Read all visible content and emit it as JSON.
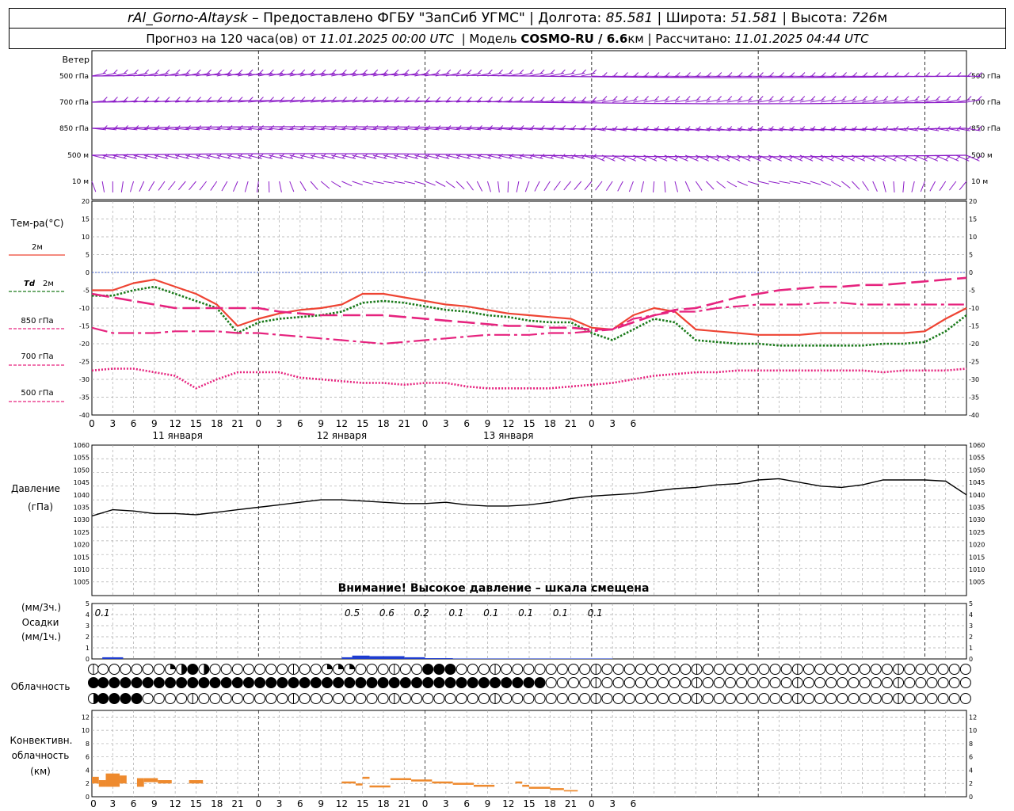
{
  "header": {
    "station": "rAl_Gorno-Altaysk",
    "provider": " – Предоставлено ФГБУ \"ЗапСиб УГМС\" | Долгота: ",
    "lon": "85.581",
    "lat_label": " | Широта: ",
    "lat": "51.581",
    "alt_label": " | Высота: ",
    "alt": "726",
    "alt_unit": "м",
    "fc_label": "Прогноз на 120 часа(ов) от ",
    "fc_time": "11.01.2025 00:00 UTC",
    "model_label": "  | Модель ",
    "model": "COSMO-RU / 6.6",
    "model_unit": "км",
    "calc_label": " | Рассчитано: ",
    "calc_time": "11.01.2025 04:44 UTC"
  },
  "colors": {
    "wind": "#8c1cc8",
    "t2m": "#ee4433",
    "td2m": "#1a7a1a",
    "t850": "#e6237e",
    "t700": "#e6237e",
    "t500": "#e6237e",
    "pressure": "#000000",
    "precip": "#1e3ccf",
    "conv": "#ee8a2e",
    "zero_line": "#4060d0"
  },
  "axes": {
    "hour_ticks": [
      "0",
      "3",
      "6",
      "9",
      "12",
      "15",
      "18",
      "21",
      "0",
      "3",
      "6",
      "9",
      "12",
      "15",
      "18",
      "21",
      "0",
      "3",
      "6",
      "9",
      "12",
      "15",
      "18",
      "21",
      "0",
      "3",
      "6"
    ],
    "days": [
      "11 января",
      "12 января",
      "13 января"
    ],
    "temp_ticks": [
      "20",
      "15",
      "10",
      "5",
      "0",
      "-5",
      "-10",
      "-15",
      "-20",
      "-25",
      "-30",
      "-35",
      "-40"
    ],
    "press_ticks": [
      "1060",
      "1055",
      "1050",
      "1045",
      "1040",
      "1035",
      "1030",
      "1025",
      "1020",
      "1015",
      "1010",
      "1005"
    ],
    "precip_ticks": [
      "5",
      "4",
      "3",
      "2",
      "1",
      "0"
    ],
    "conv_ticks": [
      "12",
      "10",
      "8",
      "6",
      "4",
      "2",
      "0"
    ]
  },
  "labels": {
    "wind": "Ветер",
    "wind_levels": [
      "500 гПа",
      "700 гПа",
      "850 гПа",
      "500  м",
      "10   м"
    ],
    "temp": "Тем-ра(°С)",
    "t2m": "2м",
    "td": "Td",
    "td2m": "2м",
    "t850": "850 гПа",
    "t700": "700 гПа",
    "t500": "500 гПа",
    "pressure1": "Давление",
    "pressure2": "(гПа)",
    "pressure_warning": "Внимание! Высокое давление – шкала смещена",
    "precip1": "(мм/3ч.)",
    "precip2": "Осадки",
    "precip3": "(мм/1ч.)",
    "cloud": "Облачность",
    "conv1": "Конвективн.",
    "conv2": "облачность",
    "conv3": "(км)"
  },
  "chart_data": [
    {
      "type": "line",
      "title": "Тем-ра(°С)",
      "x_hours": [
        0,
        3,
        6,
        9,
        12,
        15,
        18,
        21,
        24,
        27,
        30,
        33,
        36,
        39,
        42,
        45,
        48,
        51,
        54,
        57,
        60,
        63,
        66,
        69,
        72,
        75,
        78,
        81,
        84,
        87,
        90,
        93,
        96,
        99,
        102,
        105,
        108,
        111,
        114,
        117,
        120,
        123,
        126
      ],
      "ylim": [
        -40,
        20
      ],
      "series": [
        {
          "name": "2м",
          "style": "solid",
          "values": [
            -5,
            -5,
            -3,
            -2,
            -4,
            -6,
            -9,
            -15,
            -13,
            -11.5,
            -10.5,
            -10,
            -9,
            -6,
            -6,
            -7,
            -8,
            -9,
            -9.5,
            -10.5,
            -11.5,
            -12,
            -12.5,
            -13,
            -15.5,
            -16,
            -12,
            -10,
            -11,
            -16,
            -16.5,
            -17,
            -17.5,
            -17.5,
            -17.5,
            -17,
            -17,
            -17,
            -17,
            -17,
            -16.5,
            -13,
            -10
          ]
        },
        {
          "name": "Td 2м",
          "style": "dotted",
          "values": [
            -6.5,
            -6.5,
            -5,
            -4,
            -6,
            -8,
            -10,
            -17,
            -14,
            -13,
            -12.5,
            -12,
            -11,
            -8.5,
            -8,
            -8.5,
            -9.5,
            -10.5,
            -11,
            -12,
            -12.5,
            -13.5,
            -14,
            -14,
            -17,
            -19,
            -16,
            -13,
            -14,
            -19,
            -19.5,
            -20,
            -20,
            -20.5,
            -20.5,
            -20.5,
            -20.5,
            -20.5,
            -20,
            -20,
            -19.5,
            -16.5,
            -12
          ]
        },
        {
          "name": "850 гПа",
          "style": "long-dash",
          "values": [
            -6,
            -7,
            -8,
            -9,
            -10,
            -10,
            -10,
            -10,
            -10,
            -11,
            -11.5,
            -12,
            -12,
            -12,
            -12,
            -12.5,
            -13,
            -13.5,
            -14,
            -14.5,
            -15,
            -15,
            -15.5,
            -15.5,
            -16,
            -16,
            -14,
            -12,
            -10.5,
            -10,
            -8.5,
            -7,
            -6,
            -5,
            -4.5,
            -4,
            -4,
            -3.5,
            -3.5,
            -3,
            -2.5,
            -2,
            -1.5
          ]
        },
        {
          "name": "700 гПа",
          "style": "dash-dot",
          "values": [
            -15.5,
            -17,
            -17,
            -17,
            -16.5,
            -16.5,
            -16.5,
            -17,
            -17,
            -17.5,
            -18,
            -18.5,
            -19,
            -19.5,
            -20,
            -19.5,
            -19,
            -18.5,
            -18,
            -17.5,
            -17.5,
            -17.5,
            -17,
            -17,
            -16.5,
            -16,
            -13,
            -12,
            -11,
            -11,
            -10,
            -9.5,
            -9,
            -9,
            -9,
            -8.5,
            -8.5,
            -9,
            -9,
            -9,
            -9,
            -9,
            -9
          ]
        },
        {
          "name": "500 гПа",
          "style": "fine-dot",
          "values": [
            -27.5,
            -27,
            -27,
            -28,
            -29,
            -32.5,
            -30,
            -28,
            -28,
            -28,
            -29.5,
            -30,
            -30.5,
            -31,
            -31,
            -31.5,
            -31,
            -31,
            -32,
            -32.5,
            -32.5,
            -32.5,
            -32.5,
            -32,
            -31.5,
            -31,
            -30,
            -29,
            -28.5,
            -28,
            -28,
            -27.5,
            -27.5,
            -27.5,
            -27.5,
            -27.5,
            -27.5,
            -27.5,
            -28,
            -27.5,
            -27.5,
            -27.5,
            -27
          ]
        }
      ]
    },
    {
      "type": "line",
      "title": "Давление",
      "ylabel": "(гПа)",
      "x_hours": [
        0,
        3,
        6,
        9,
        12,
        15,
        18,
        21,
        24,
        27,
        30,
        33,
        36,
        39,
        42,
        45,
        48,
        51,
        54,
        57,
        60,
        63,
        66,
        69,
        72,
        75,
        78,
        81,
        84,
        87,
        90,
        93,
        96,
        99,
        102,
        105,
        108,
        111,
        114,
        117,
        120,
        123,
        126
      ],
      "ylim": [
        1005,
        1060
      ],
      "series": [
        {
          "name": "Давление",
          "values": [
            1031.5,
            1034,
            1033.5,
            1032.5,
            1032.5,
            1032,
            1033,
            1034,
            1035,
            1036,
            1037,
            1038,
            1038,
            1037.5,
            1037,
            1036.5,
            1036.5,
            1037,
            1036,
            1035.5,
            1035.5,
            1036,
            1037,
            1038.5,
            1039.5,
            1040,
            1040.5,
            1041.5,
            1042.5,
            1043,
            1044,
            1044.5,
            1046,
            1046.5,
            1045,
            1043.5,
            1043,
            1044,
            1046,
            1046,
            1046,
            1045.5,
            1040
          ]
        }
      ]
    },
    {
      "type": "bar",
      "title": "Осадки",
      "ylabel": "(мм/1ч.)",
      "ylim": [
        0,
        5
      ],
      "labels_3h": [
        {
          "hour": 1.5,
          "text": "0.1"
        },
        {
          "hour": 37.5,
          "text": "0.5"
        },
        {
          "hour": 42.5,
          "text": "0.6"
        },
        {
          "hour": 47.5,
          "text": "0.2"
        },
        {
          "hour": 52.5,
          "text": "0.1"
        },
        {
          "hour": 57.5,
          "text": "0.1"
        },
        {
          "hour": 62.5,
          "text": "0.1"
        },
        {
          "hour": 67.5,
          "text": "0.1"
        },
        {
          "hour": 72.5,
          "text": "0.1"
        }
      ],
      "bars": [
        {
          "start": 1.5,
          "end": 4.5,
          "value": 0.15
        },
        {
          "start": 36,
          "end": 37.5,
          "value": 0.15
        },
        {
          "start": 37.5,
          "end": 40,
          "value": 0.3
        },
        {
          "start": 40,
          "end": 45,
          "value": 0.25
        },
        {
          "start": 45,
          "end": 48,
          "value": 0.15
        },
        {
          "start": 48,
          "end": 52,
          "value": 0.07
        },
        {
          "start": 52,
          "end": 75,
          "value": 0.04
        }
      ]
    },
    {
      "type": "table",
      "title": "Облачность",
      "rows": [
        "hhhhhhhhhhhhhhhhhhhhhhhhhhhhhhhhhhhhhhhhhhhhhhhhhhhhhhhhhhhhhhhhhhhhhhhhhhhhhhhhhhhhhhhhhhhhhhhhhhhhhhhhhhhhhhhhhhhhhhhhhhhhhh",
        "hhhhhhhhhhhhhhhhhhhhhhhhhhhhhhhhhhhhhhhhhhhhhhhhhhhhhhhhhhhhhhhhhhhhhhhhhhhhhhhhhhhhhhhhhhhhhhhhhhhhhhhhhhhhhhhhhhhhhhhhhhhhhh",
        "hhhhhhhhhhhhhhhhhhhhhhhhhhhhhhhhhhhhhhhhhhhhhhhhhhhhhhhhhhhhhhhhhhhhhhhhhhhhhhhhhhhhhhhhhhhhhhhhhhhhhhhhhhhhhhhhhhhhhhhhhhhhhh"
      ],
      "cells": [
        "eeeeeeqhheeeeeeeeeeeqqeeeeeeeeeeeeeeeeeeeeeeeeeeeeeeeeeeeeeeeeeeeeeeeeeeeeeeeeeeeeeeeeeeeeeeeeeeeeeeeeeeeeeeeeeeeeeeeeeeqeee",
        "fffffffffffffffffffffffffffffffffffffffffffffffffffffffffffffffffffffffffffffffffffffffffffffffffffffffffffffffffffffffffffff",
        "hfffffeeeeeeeeeeeeeeeeeeeeeeeeeeeeeeeeeeeeeeeeeeeeeeeeeeeeeeeeeeeeeeeeeeeeeeeeeeeeeeeeeeeeeeeeeeeeeeeeeeeeeeeeeeeeeeeeeeeeeee"
      ],
      "cloud_rows": [
        "OOOOOOOQHFHOOOOOOOOOOQQQOOOOOOFFFOOOOOOOOOOOOOOOOOOOOOOOOOOOOOOOOOOOOOOOOOOOOOOOOOOOOOOOOOOOOOOOOOOOOOOQOO",
        "FFFFFFFFFFFFFFFFFFFFFFFFFFFFFFFFFFFFFFFFFOOOOOOOOOOOOOOOOOOOOOOOOOOOOOOOOOOOOOOOOOOOOOOOOOOOOOOOOOOOOO",
        "HFFFFOOOOOOOOOOOOOOOOOOOOOOOOOOOOOOOOOOOOOOOOOOOOOOOOOOOOOOOOOOOOOOOOOOOOOOOOOOOOOOOOOOOOOOOOOOOOOOOOOO"
      ]
    },
    {
      "type": "bar",
      "title": "Конвективн. облачность",
      "ylabel": "(км)",
      "ylim": [
        0,
        13
      ],
      "bars": [
        {
          "start": 0,
          "end": 1,
          "bottom": 2,
          "top": 3
        },
        {
          "start": 1,
          "end": 2,
          "bottom": 1.5,
          "top": 2.5
        },
        {
          "start": 2,
          "end": 4,
          "bottom": 1.5,
          "top": 3.5
        },
        {
          "start": 4,
          "end": 5,
          "bottom": 2,
          "top": 3.2
        },
        {
          "start": 6.5,
          "end": 7.5,
          "bottom": 1.5,
          "top": 2.8
        },
        {
          "start": 7.5,
          "end": 9.5,
          "bottom": 2.2,
          "top": 2.8
        },
        {
          "start": 9.5,
          "end": 11.5,
          "bottom": 2,
          "top": 2.5
        },
        {
          "start": 14,
          "end": 16,
          "bottom": 2,
          "top": 2.5
        },
        {
          "start": 36,
          "end": 38,
          "bottom": 2,
          "top": 2.3
        },
        {
          "start": 38,
          "end": 39,
          "bottom": 1.7,
          "top": 2
        },
        {
          "start": 39,
          "end": 40,
          "bottom": 2.7,
          "top": 3
        },
        {
          "start": 40,
          "end": 43,
          "bottom": 1.4,
          "top": 1.7
        },
        {
          "start": 43,
          "end": 46,
          "bottom": 2.5,
          "top": 2.8
        },
        {
          "start": 46,
          "end": 49,
          "bottom": 2.3,
          "top": 2.6
        },
        {
          "start": 49,
          "end": 52,
          "bottom": 2,
          "top": 2.3
        },
        {
          "start": 52,
          "end": 55,
          "bottom": 1.8,
          "top": 2.1
        },
        {
          "start": 55,
          "end": 58,
          "bottom": 1.5,
          "top": 1.8
        },
        {
          "start": 61,
          "end": 62,
          "bottom": 2,
          "top": 2.3
        },
        {
          "start": 62,
          "end": 63,
          "bottom": 1.5,
          "top": 1.8
        },
        {
          "start": 63,
          "end": 66,
          "bottom": 1.2,
          "top": 1.5
        },
        {
          "start": 66,
          "end": 68,
          "bottom": 1,
          "top": 1.3
        },
        {
          "start": 68,
          "end": 70,
          "bottom": 0.8,
          "top": 1
        }
      ]
    }
  ]
}
